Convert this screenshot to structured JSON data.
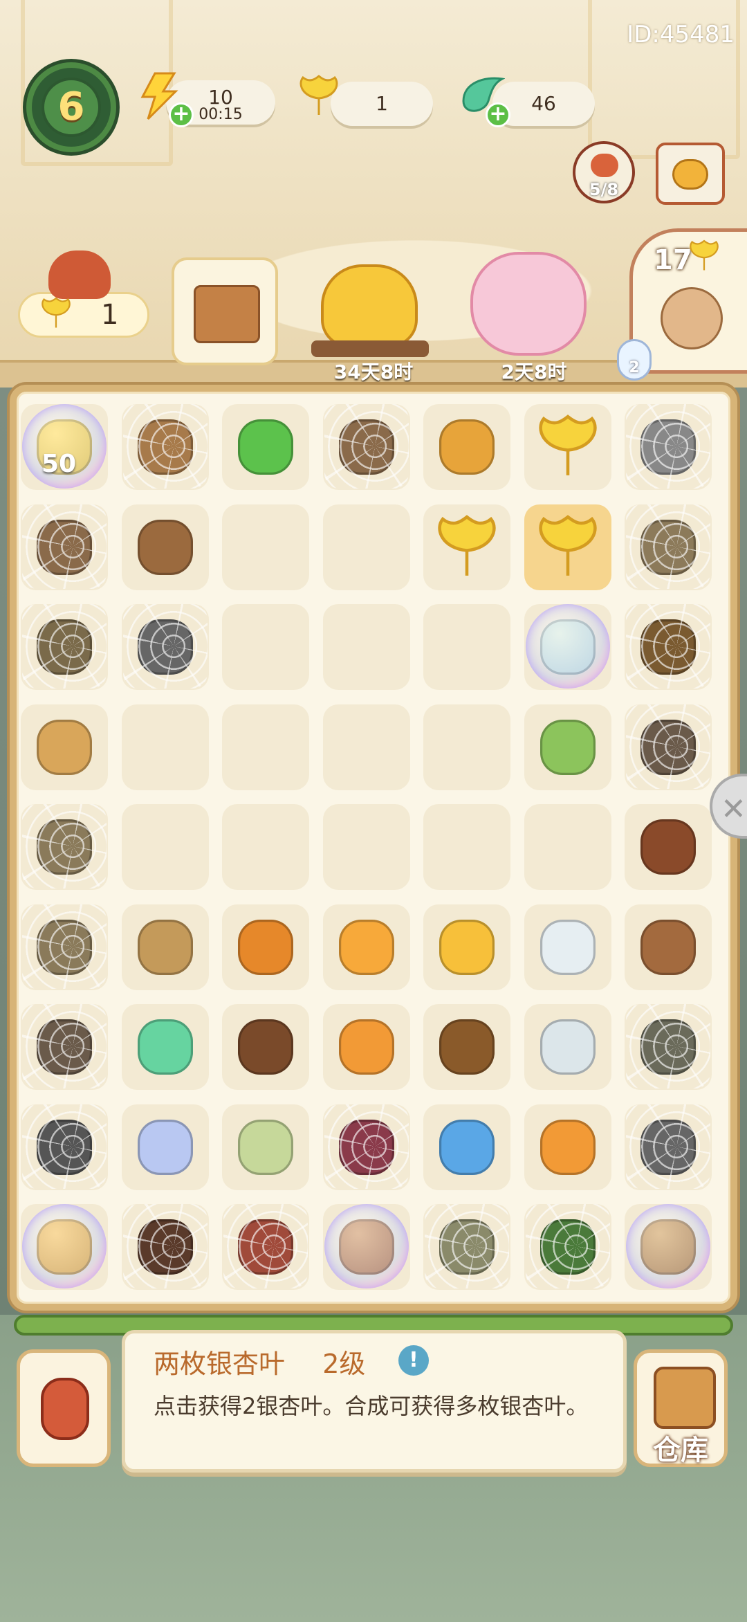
{
  "header": {
    "id_label": "ID:45481",
    "level": "6",
    "energy": {
      "value": "10",
      "timer": "00:15",
      "icon": "bolt-icon"
    },
    "gingko": {
      "value": "1",
      "icon": "gingko-leaf-icon"
    },
    "gem": {
      "value": "46",
      "icon": "green-gem-icon"
    },
    "panda_counter": "5/8",
    "shop_icon": "cat-shop-icon"
  },
  "characters": {
    "panda_leaf_count": "1",
    "teapot_timer": "34天8时",
    "cake_timer": "2天8时",
    "right_card_leaf_count": "17",
    "egg_count": "2"
  },
  "board": {
    "badge_count": "50"
  },
  "info": {
    "title": "两枚银杏叶",
    "level": "2级",
    "info_icon_label": "!",
    "description": "点击获得2银杏叶。合成可获得多枚银杏叶。"
  },
  "bottom": {
    "storage_label": "仓库"
  },
  "colors": {
    "board_border": "#d7b477",
    "cell": "#f3ead3",
    "title_color": "#b96a2c",
    "bamboo": "#7db14e"
  }
}
